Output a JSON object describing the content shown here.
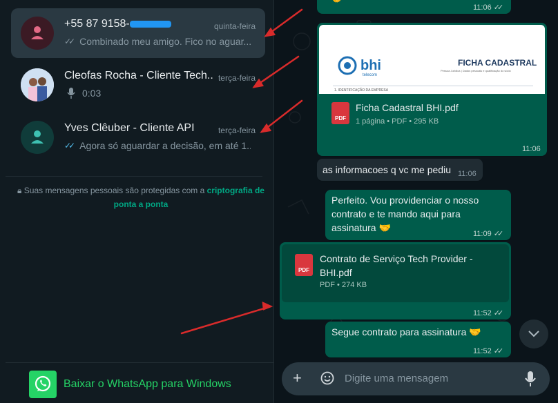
{
  "sidebar": {
    "chats": [
      {
        "name": "+55 87 9158-",
        "time": "quinta-feira",
        "preview": "Combinado meu amigo. Fico no aguar...",
        "tick": "read-gray"
      },
      {
        "name": "Cleofas Rocha - Cliente Tech...",
        "time": "terça-feira",
        "preview": "0:03",
        "tick": "mic"
      },
      {
        "name": "Yves Clêuber - Cliente API",
        "time": "terça-feira",
        "preview": "Agora só aguardar a decisão, em até 1...",
        "tick": "read-blue"
      }
    ],
    "encryption_text": "Suas mensagens pessoais são protegidas com a",
    "encryption_link": "criptografia de ponta a ponta",
    "download_label": "Baixar o WhatsApp para Windows"
  },
  "chat": {
    "messages": {
      "m0_time": "11:06",
      "doc1": {
        "preview_brand": "bhi",
        "preview_brand_sub": "telecom",
        "preview_title": "FICHA CADASTRAL",
        "preview_subtitle": "Pessoa Jurídica | Dados pessoais e qualificação do sócio",
        "preview_section": "1. IDENTIFICAÇÃO DA EMPRESA",
        "name": "Ficha Cadastral BHI.pdf",
        "meta": "1 página • PDF • 295 KB",
        "time": "11:06"
      },
      "in1": {
        "text": "as informacoes q vc me pediu",
        "time": "11:06"
      },
      "out1": {
        "text": "Perfeito. Vou providenciar o nosso contrato e te mando aqui para assinatura 🤝",
        "time": "11:09"
      },
      "doc2": {
        "name": "Contrato de Serviço Tech Provider - BHI.pdf",
        "meta": "PDF • 274 KB",
        "time": "11:52"
      },
      "out2": {
        "text": "Segue contrato para assinatura 🤝",
        "time": "11:52"
      }
    },
    "pdf_label": "PDF",
    "compose_placeholder": "Digite uma mensagem"
  },
  "colors": {
    "accent": "#00a884",
    "out_bubble": "#005c4b",
    "in_bubble": "#202c33",
    "annotation_arrow": "#d92b2b"
  }
}
